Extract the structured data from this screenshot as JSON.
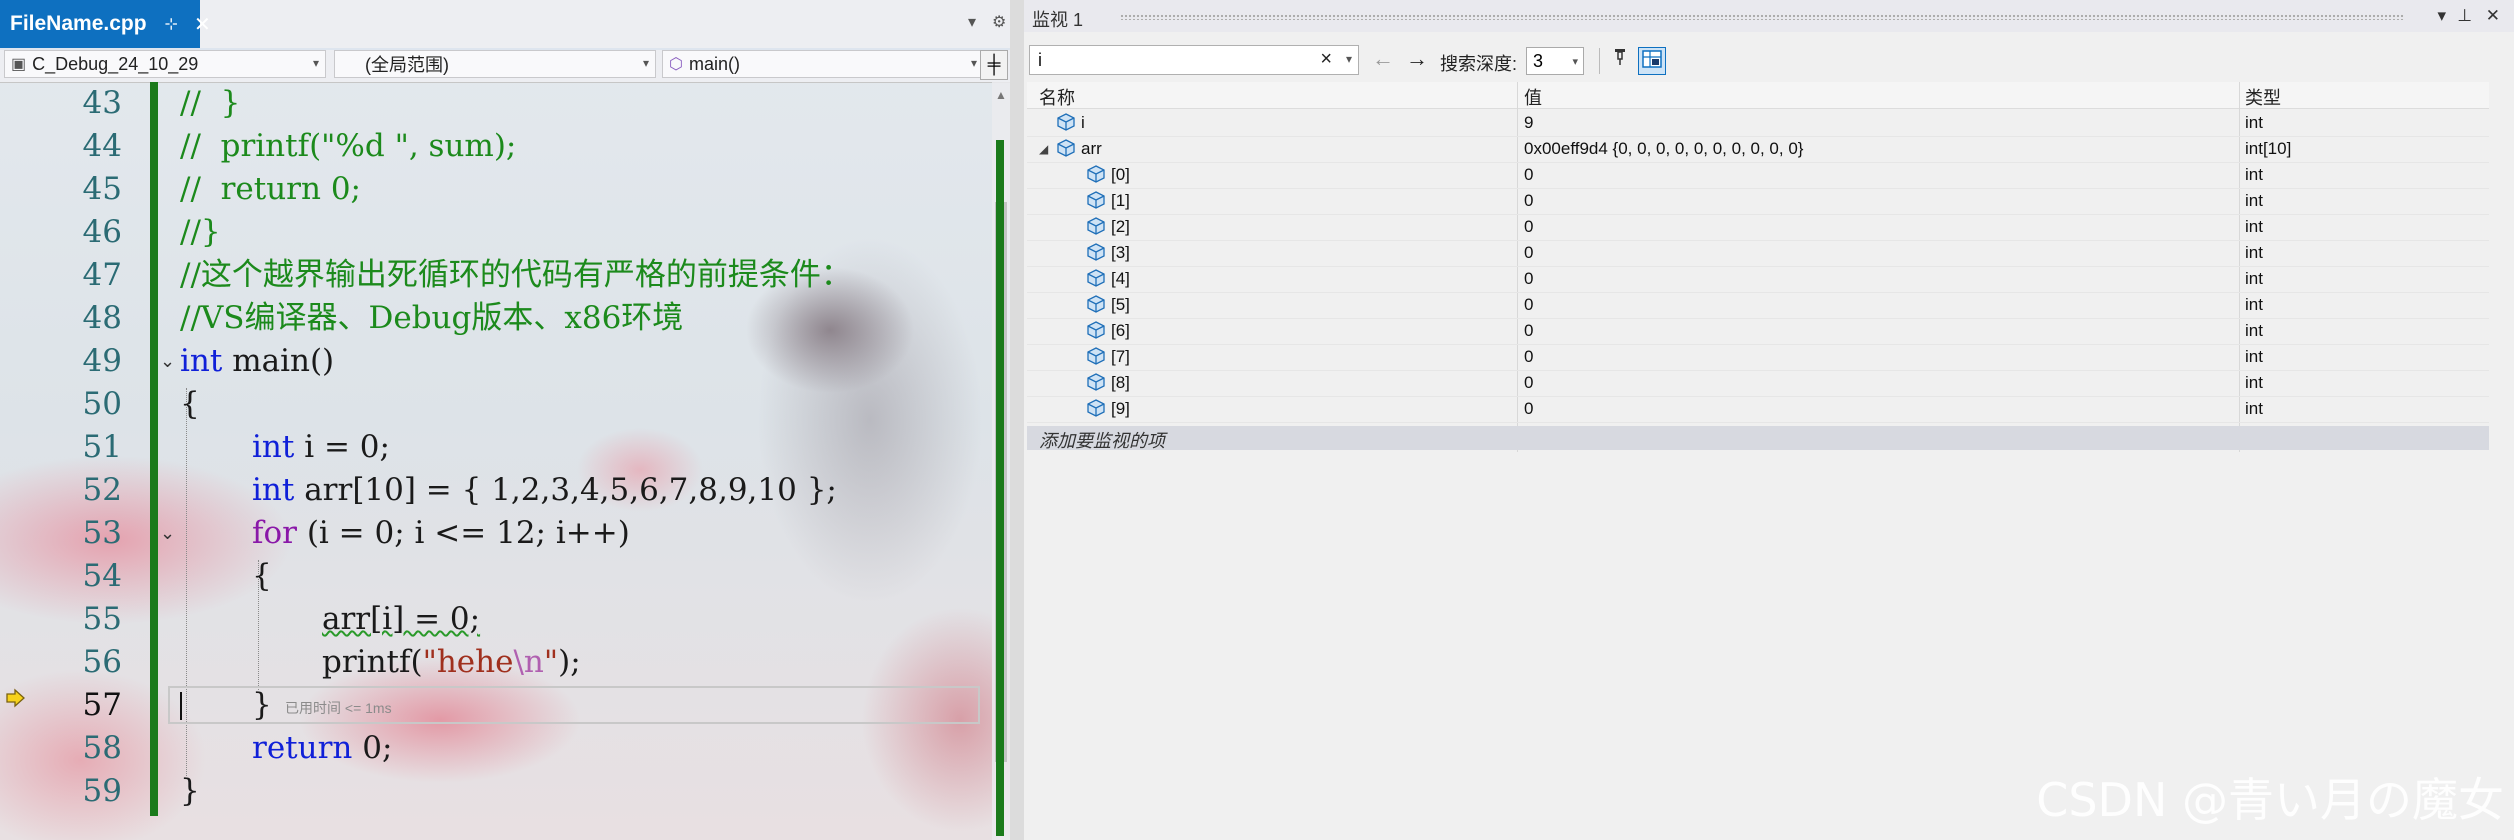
{
  "editor": {
    "file_tab": {
      "name": "FileName.cpp",
      "pin": "⊹",
      "close": "✕"
    },
    "navbar": {
      "project": "C_Debug_24_10_29",
      "scope": "(全局范围)",
      "function": "main()",
      "split": "╪"
    },
    "elapsed": "已用时间 <= 1ms",
    "lines": [
      {
        "n": "43",
        "text": "//  }"
      },
      {
        "n": "44",
        "text": "//  printf(\"%d \", sum);"
      },
      {
        "n": "45",
        "text": "//  return 0;"
      },
      {
        "n": "46",
        "text": "//}"
      },
      {
        "n": "47",
        "text": "//这个越界输出死循环的代码有严格的前提条件："
      },
      {
        "n": "48",
        "text": "//VS编译器、Debug版本、x86环境"
      },
      {
        "n": "49",
        "kw": "int",
        "rest": " main()"
      },
      {
        "n": "50",
        "text": "{"
      },
      {
        "n": "51",
        "kw": "int",
        "rest": " i = 0;"
      },
      {
        "n": "52",
        "kw": "int",
        "rest": " arr[10] = { 1,2,3,4,5,6,7,8,9,10 };"
      },
      {
        "n": "53",
        "kw": "for",
        "rest": " (i = 0; i <= 12; i++)"
      },
      {
        "n": "54",
        "text": "{"
      },
      {
        "n": "55",
        "text": "arr[i] = 0;"
      },
      {
        "n": "56",
        "fn": "printf(",
        "str1": "\"hehe",
        "esc": "\\n",
        "str2": "\"",
        "end": ");"
      },
      {
        "n": "57",
        "text": "}"
      },
      {
        "n": "58",
        "kw": "return",
        "rest": " 0;"
      },
      {
        "n": "59",
        "text": "}"
      }
    ]
  },
  "watch": {
    "title": "监视 1",
    "search_value": "i",
    "search_depth_label": "搜索深度:",
    "search_depth_value": "3",
    "columns": {
      "name": "名称",
      "value": "值",
      "type": "类型"
    },
    "rows": [
      {
        "name": "i",
        "value": "9",
        "type": "int",
        "level": 0,
        "expander": ""
      },
      {
        "name": "arr",
        "value": "0x00eff9d4 {0, 0, 0, 0, 0, 0, 0, 0, 0, 0}",
        "type": "int[10]",
        "level": 0,
        "expander": "◢"
      },
      {
        "name": "[0]",
        "value": "0",
        "type": "int",
        "level": 1,
        "expander": ""
      },
      {
        "name": "[1]",
        "value": "0",
        "type": "int",
        "level": 1,
        "expander": ""
      },
      {
        "name": "[2]",
        "value": "0",
        "type": "int",
        "level": 1,
        "expander": ""
      },
      {
        "name": "[3]",
        "value": "0",
        "type": "int",
        "level": 1,
        "expander": ""
      },
      {
        "name": "[4]",
        "value": "0",
        "type": "int",
        "level": 1,
        "expander": ""
      },
      {
        "name": "[5]",
        "value": "0",
        "type": "int",
        "level": 1,
        "expander": ""
      },
      {
        "name": "[6]",
        "value": "0",
        "type": "int",
        "level": 1,
        "expander": ""
      },
      {
        "name": "[7]",
        "value": "0",
        "type": "int",
        "level": 1,
        "expander": ""
      },
      {
        "name": "[8]",
        "value": "0",
        "type": "int",
        "level": 1,
        "expander": ""
      },
      {
        "name": "[9]",
        "value": "0",
        "type": "int",
        "level": 1,
        "expander": ""
      }
    ],
    "add_item": "添加要监视的项"
  },
  "watermark": "CSDN @青い月の魔女",
  "colors": {
    "accent": "#0e70c0",
    "comment": "#1c8a1c",
    "keyword": "#1020d8",
    "string": "#a0301e",
    "change_bar": "#1b7a1b"
  }
}
